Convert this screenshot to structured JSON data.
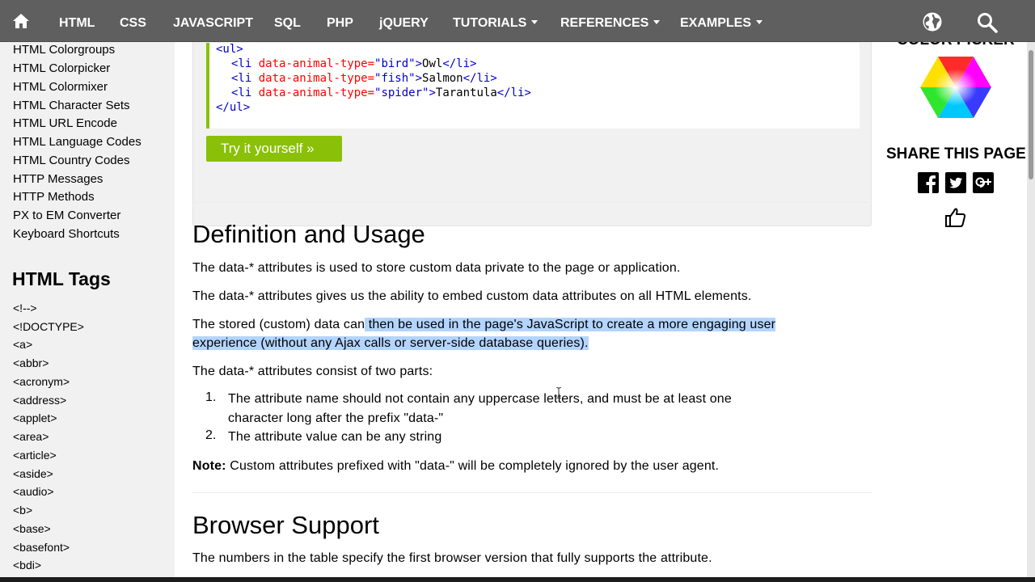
{
  "nav": {
    "items": [
      {
        "label": "HTML",
        "dropdown": false
      },
      {
        "label": "CSS",
        "dropdown": false
      },
      {
        "label": "JAVASCRIPT",
        "dropdown": false
      },
      {
        "label": "SQL",
        "dropdown": false
      },
      {
        "label": "PHP",
        "dropdown": false
      },
      {
        "label": "jQUERY",
        "dropdown": false
      },
      {
        "label": "TUTORIALS",
        "dropdown": true
      },
      {
        "label": "REFERENCES",
        "dropdown": true
      },
      {
        "label": "EXAMPLES",
        "dropdown": true
      }
    ],
    "icons": [
      "home-icon",
      "globe-icon",
      "search-icon"
    ]
  },
  "sidebar": {
    "references": [
      "HTML Colorgroups",
      "HTML Colorpicker",
      "HTML Colormixer",
      "HTML Character Sets",
      "HTML URL Encode",
      "HTML Language Codes",
      "HTML Country Codes",
      "HTTP Messages",
      "HTTP Methods",
      "PX to EM Converter",
      "Keyboard Shortcuts"
    ],
    "tags_heading": "HTML Tags",
    "tags": [
      "<!-->",
      "<!DOCTYPE>",
      "<a>",
      "<abbr>",
      "<acronym>",
      "<address>",
      "<applet>",
      "<area>",
      "<article>",
      "<aside>",
      "<audio>",
      "<b>",
      "<base>",
      "<basefont>",
      "<bdi>"
    ]
  },
  "example": {
    "code": {
      "ul_open": "<ul>",
      "items": [
        {
          "open": "<li",
          "attr": " data-animal-type=",
          "value": "\"bird\"",
          "close_bracket": ">",
          "text": "Owl",
          "end": "</li>"
        },
        {
          "open": "<li",
          "attr": " data-animal-type=",
          "value": "\"fish\"",
          "close_bracket": ">",
          "text": "Salmon",
          "end": "</li>"
        },
        {
          "open": "<li",
          "attr": " data-animal-type=",
          "value": "\"spider\"",
          "close_bracket": ">",
          "text": "Tarantula",
          "end": "</li>"
        }
      ],
      "ul_close": "</ul>"
    },
    "try_button": "Try it yourself »"
  },
  "content": {
    "definition_heading": "Definition and Usage",
    "p1": "The data-* attributes is used to store custom data private to the page or application.",
    "p2": "The data-* attributes gives us the ability to embed custom data attributes on all HTML elements.",
    "p3_plain": "The stored (custom) data can",
    "p3_highlight_line1": " then be used in the page's JavaScript to create a more engaging user ",
    "p3_highlight_line2": "experience (without any Ajax calls or server-side database queries).",
    "p4": "The data-* attributes consist of two parts:",
    "list": [
      {
        "num": "1.",
        "line1": "The attribute name should not contain any uppercase letters, and must be at least one",
        "line2": "character long after the prefix \"data-\""
      },
      {
        "num": "2.",
        "line1": "The attribute value can be any string",
        "line2": ""
      }
    ],
    "note_label": "Note:",
    "note_text": " Custom attributes prefixed with \"data-\" will be completely ignored by the user agent.",
    "browser_heading": "Browser Support",
    "browser_p": "The numbers in the table specify the first browser version that fully supports the attribute."
  },
  "right": {
    "picker_title": "COLOR PICKER",
    "share_title": "SHARE THIS PAGE",
    "social_icons": [
      "facebook-icon",
      "twitter-icon",
      "google-plus-icon",
      "thumbs-up-icon"
    ]
  },
  "colors": {
    "nav_bg": "#5f5f5f",
    "accent_green": "#8ac007",
    "sidebar_bg": "#f1f1f1",
    "selection": "#b3d4fd"
  }
}
